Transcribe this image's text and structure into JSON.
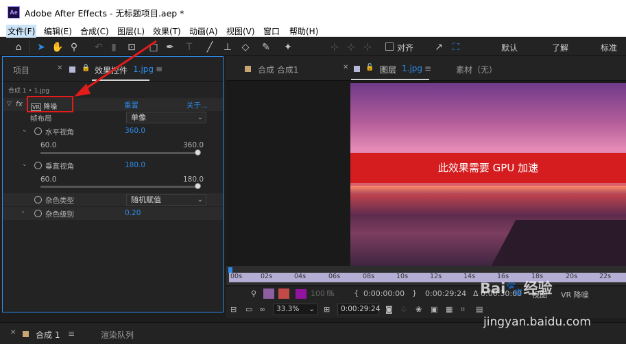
{
  "app": {
    "title": "Adobe After Effects - 无标题项目.aep *",
    "logo": "Ae"
  },
  "menu": [
    "文件(F)",
    "编辑(E)",
    "合成(C)",
    "图层(L)",
    "效果(T)",
    "动画(A)",
    "视图(V)",
    "窗口",
    "帮助(H)"
  ],
  "toolbar": {
    "snap_label": "对齐",
    "workspaces": [
      "默认",
      "了解",
      "标准"
    ]
  },
  "left_panel": {
    "tabs": {
      "project": "项目",
      "effect_controls": "效果控件",
      "effect_controls_layer": "1.jpg"
    },
    "subtitle": "合成 1 • 1.jpg",
    "effect": {
      "fx": "fx",
      "vr_badge": "VR",
      "name": "降噪",
      "reset": "重置",
      "about": "关于..."
    },
    "params": {
      "frame_layout": {
        "label": "帧布局",
        "value": "单像"
      },
      "h_fov": {
        "label": "水平视角",
        "value": "360.0",
        "min": "60.0",
        "max": "360.0",
        "fraction": 1.0
      },
      "v_fov": {
        "label": "垂直视角",
        "value": "180.0",
        "min": "60.0",
        "max": "180.0",
        "fraction": 1.0
      },
      "noise_type": {
        "label": "杂色类型",
        "value": "随机赋值"
      },
      "noise_level": {
        "label": "杂色级别",
        "value": "0.20"
      }
    }
  },
  "right_panel": {
    "tabs": {
      "comp": "合成 合成1",
      "layer": "图层",
      "layer_name": "1.jpg",
      "footage": "素材（无）"
    },
    "banner": "此效果需要 GPU 加速",
    "ruler": [
      "00s",
      "02s",
      "04s",
      "06s",
      "08s",
      "10s",
      "12s",
      "14s",
      "16s",
      "18s",
      "20s",
      "22s"
    ],
    "controls": {
      "opacity": "100 %",
      "in_time": "0:00:00:00",
      "out_time": "0:00:29:24",
      "duration": "Δ 0:00:30:00",
      "view": "视图",
      "vr_label": "VR 降噪"
    },
    "viewer_controls": {
      "zoom": "33.3%",
      "timecode": "0:00:29:24"
    }
  },
  "bottom": {
    "comp_tab": "合成 1",
    "render_queue": "渲染队列"
  },
  "watermark": {
    "line1": "Bai🐾经验",
    "line2": "jingyan.baidu.com"
  },
  "colors": {
    "accent": "#2d8ceb",
    "highlight": "#e31b1b",
    "banner": "#d51d1f"
  }
}
